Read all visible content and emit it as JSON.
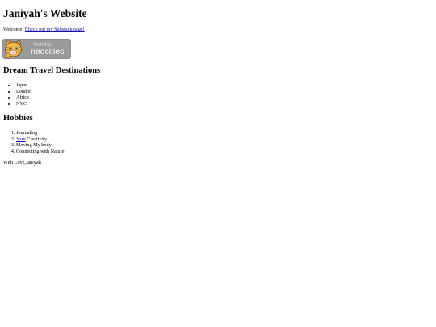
{
  "header": {
    "title": "Janiyah's Website"
  },
  "welcome": {
    "text": "Welcome!",
    "link_label": "Check out my Substack page!"
  },
  "badge": {
    "small_text": "hosted by",
    "brand_text": "neocities",
    "icon": "neocities-cat-logo"
  },
  "travel": {
    "heading": "Dream Travel Destinations",
    "items": [
      "Japan",
      "London",
      "Africa",
      "NYC"
    ]
  },
  "hobbies": {
    "heading": "Hobbies",
    "items": [
      {
        "text": "Journaling"
      },
      {
        "link": "Yarn",
        "text": "Creativity"
      },
      {
        "text": "Moving My body"
      },
      {
        "text": "Connecting with Nature"
      }
    ]
  },
  "signoff": {
    "text": "With Love,Janiyah"
  }
}
